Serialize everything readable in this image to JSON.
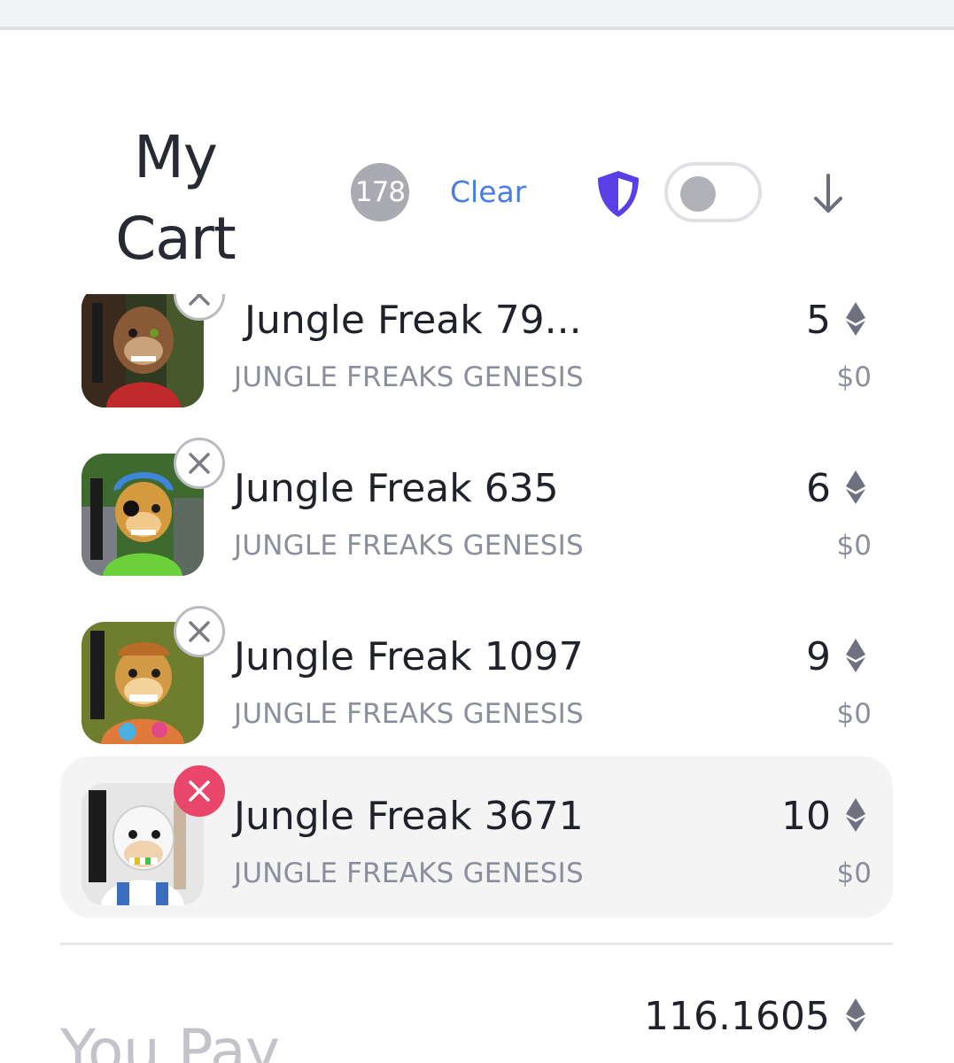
{
  "header": {
    "title_line1": "My",
    "title_line2": "Cart",
    "count": "178",
    "clear_label": "Clear",
    "toggle_on": false,
    "shield_color": "#5b3fe6"
  },
  "items": [
    {
      "name": "Jungle Freak 79...",
      "collection": "JUNGLE FREAKS GENESIS",
      "price": "5",
      "usd": "$0",
      "remove_style": "default"
    },
    {
      "name": "Jungle Freak 635",
      "collection": "JUNGLE FREAKS GENESIS",
      "price": "6",
      "usd": "$0",
      "remove_style": "default"
    },
    {
      "name": "Jungle Freak 1097",
      "collection": "JUNGLE FREAKS GENESIS",
      "price": "9",
      "usd": "$0",
      "remove_style": "default"
    },
    {
      "name": "Jungle Freak 3671",
      "collection": "JUNGLE FREAKS GENESIS",
      "price": "10",
      "usd": "$0",
      "remove_style": "danger",
      "selected": true
    }
  ],
  "footer": {
    "total": "116.1605",
    "label": "You Pay"
  },
  "colors": {
    "accent": "#4a7de0",
    "danger": "#e8476b",
    "muted_text": "#8b8f9b"
  }
}
